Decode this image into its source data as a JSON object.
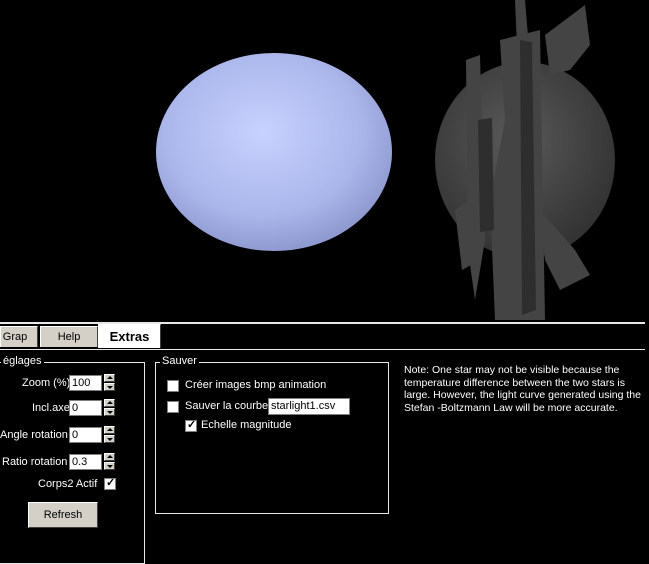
{
  "tabs": [
    {
      "label": "Grap"
    },
    {
      "label": "Help"
    },
    {
      "label": "Extras"
    }
  ],
  "reglages": {
    "legend": "églages",
    "zoom_label": "Zoom (%)",
    "zoom_value": "100",
    "incl_label": "Incl.axes",
    "incl_value": "0",
    "angle_label": "Angle rotation",
    "angle_value": "0",
    "ratio_label": "Ratio rotation",
    "ratio_value": "0.3",
    "corps2_label": "Corps2 Actif",
    "corps2_checked": true,
    "refresh_label": "Refresh"
  },
  "sauver": {
    "legend": "Sauver",
    "bmp_label": "Créer images bmp animation",
    "bmp_checked": false,
    "courbe_label": "Sauver la courbe",
    "courbe_checked": false,
    "filename": "starlight1.csv",
    "echelle_label": "Echelle magnitude",
    "echelle_checked": true
  },
  "note": "Note: One star may not be visible because the temperature difference between the two stars is large. However, the light curve generated using the Stefan -Boltzmann Law will be more accurate.",
  "colors": {
    "star1": "#b8c4f0",
    "star2": "#4a4a4a",
    "background": "#000000"
  }
}
